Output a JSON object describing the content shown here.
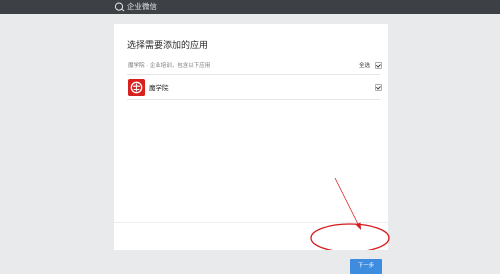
{
  "header": {
    "brand": "企业微信",
    "logo_icon": "wechat-work-logo-icon"
  },
  "dialog": {
    "title": "选择需要添加的应用",
    "subtitle": "魔学院 · 企业培训，包含以下应用",
    "select_all_label": "全选",
    "select_all_checked": true,
    "apps": [
      {
        "name": "魔学院",
        "icon": "mo-xueyuan-app-icon",
        "checked": true
      }
    ],
    "next_button": "下一步"
  },
  "annotation": {
    "color": "#d61c1c"
  }
}
